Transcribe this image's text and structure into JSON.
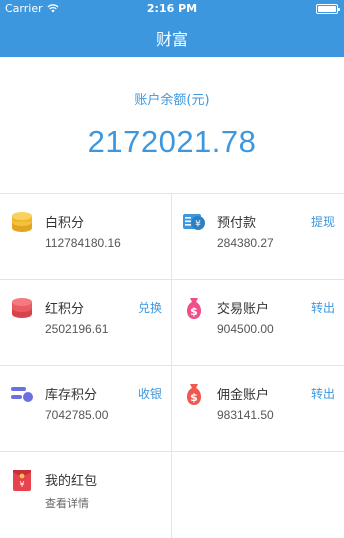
{
  "status": {
    "carrier": "Carrier",
    "time": "2:16 PM"
  },
  "nav": {
    "title": "财富"
  },
  "balance": {
    "label": "账户余额(元)",
    "value": "2172021.78"
  },
  "items": [
    {
      "title": "白积分",
      "value": "112784180.16",
      "action": "",
      "icon": "coins-icon",
      "color": "#f0b72f"
    },
    {
      "title": "预付款",
      "value": "284380.27",
      "action": "提现",
      "icon": "prepaid-card-icon",
      "color": "#3d97df"
    },
    {
      "title": "红积分",
      "value": "2502196.61",
      "action": "兑换",
      "icon": "red-coins-icon",
      "color": "#eb5b63"
    },
    {
      "title": "交易账户",
      "value": "904500.00",
      "action": "转出",
      "icon": "money-bag-icon",
      "color": "#f0508a"
    },
    {
      "title": "库存积分",
      "value": "7042785.00",
      "action": "收银",
      "icon": "inventory-toggle-icon",
      "color": "#6b6fe0"
    },
    {
      "title": "佣金账户",
      "value": "983141.50",
      "action": "转出",
      "icon": "money-bag-icon",
      "color": "#ee5a52"
    }
  ],
  "red_packet": {
    "title": "我的红包",
    "subtitle": "查看详情",
    "icon": "red-packet-icon",
    "color": "#e8424f"
  }
}
